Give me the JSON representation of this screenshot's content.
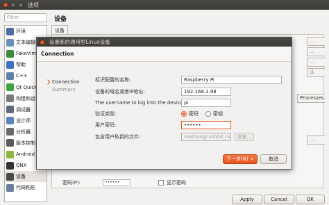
{
  "window": {
    "title": "选项"
  },
  "filter": {
    "placeholder": "Filter"
  },
  "categories": [
    {
      "label": "环境",
      "icon": "monitor-icon",
      "color": "#4a6fa5"
    },
    {
      "label": "文本编辑器",
      "icon": "text-editor-icon",
      "color": "#6b8fb8"
    },
    {
      "label": "FakeVim",
      "icon": "fakevim-icon",
      "color": "#3c8a3c"
    },
    {
      "label": "帮助",
      "icon": "help-icon",
      "color": "#3a73c4"
    },
    {
      "label": "C++",
      "icon": "cpp-icon",
      "color": "#5a7fa8"
    },
    {
      "label": "Qt Quick",
      "icon": "qt-quick-icon",
      "color": "#41a33f"
    },
    {
      "label": "构建和运行",
      "icon": "build-run-icon",
      "color": "#7a7a7a"
    },
    {
      "label": "调试器",
      "icon": "debugger-icon",
      "color": "#5d6b7c"
    },
    {
      "label": "设计师",
      "icon": "designer-icon",
      "color": "#5a84c0"
    },
    {
      "label": "分析器",
      "icon": "analyzer-icon",
      "color": "#6a6a6a"
    },
    {
      "label": "版本控制",
      "icon": "version-control-icon",
      "color": "#5b5b5b"
    },
    {
      "label": "Android",
      "icon": "android-icon",
      "color": "#8cb83c"
    },
    {
      "label": "QNX",
      "icon": "qnx-icon",
      "color": "#333333"
    },
    {
      "label": "设备",
      "icon": "devices-icon",
      "color": "#4b4b4b"
    },
    {
      "label": "代码粘贴",
      "icon": "code-paste-icon",
      "color": "#6a7f99"
    }
  ],
  "page": {
    "title": "设备",
    "tab": "设备",
    "side_buttons": [
      "...",
      "...",
      "...",
      "认",
      "",
      "Processes...",
      "",
      "",
      "..."
    ],
    "password_label": "密码(P):",
    "password_value": "••••••",
    "show_password": "显示密码"
  },
  "buttons": {
    "apply": "Apply",
    "cancel": "Cancel",
    "ok": "OK"
  },
  "wizard": {
    "title": "设置新的通用型Linux设备",
    "header": "Connection",
    "steps": [
      "Connection",
      "Summary"
    ],
    "fields": {
      "name_label": "标识配置的名称:",
      "name_value": "Raspberry Pi",
      "host_label": "设备的域名或者IP地址:",
      "host_value": "192.168.1.98",
      "user_label": "The username to log into the device:",
      "user_value": "pi",
      "auth_label": "验证类型:",
      "auth_password": "密码",
      "auth_key": "密钥",
      "password_label": "用户密码:",
      "password_value": "••••••",
      "key_label": "包含用户私钥的文件:",
      "key_value": "me/hong/.ssh/id_rsa",
      "browse": "浏览..."
    },
    "next": "下一步(N) >",
    "cancel": "取消"
  },
  "colors": {
    "accent": "#e95420",
    "titlebar": "#3c3b37"
  }
}
